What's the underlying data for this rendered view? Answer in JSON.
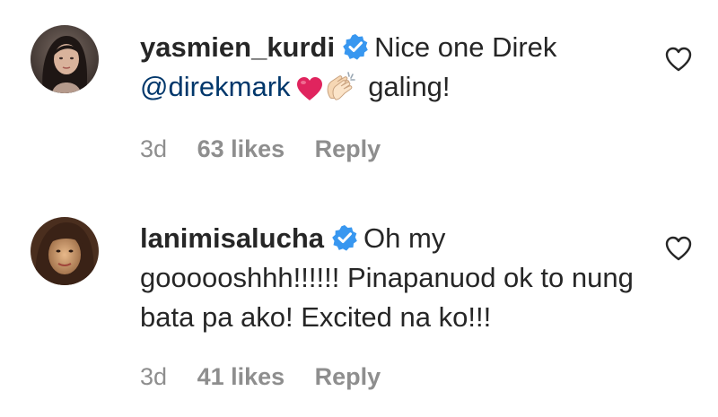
{
  "comments": [
    {
      "username": "yasmien_kurdi",
      "text_before_mention": "Nice one Direk",
      "mention": "@direkmark",
      "text_after_emoji": "galing!",
      "emoji": [
        "red-heart",
        "clapping-hands"
      ],
      "time": "3d",
      "likes": "63 likes",
      "reply": "Reply"
    },
    {
      "username": "lanimisalucha",
      "text": "Oh my goooooshhh!!!!!! Pinapanuod ok to nung bata pa ako! Excited na ko!!!",
      "time": "3d",
      "likes": "41 likes",
      "reply": "Reply"
    }
  ],
  "colors": {
    "text": "#262626",
    "mention": "#00376b",
    "meta": "#8e8e8e",
    "verified": "#3897f0",
    "heart_emoji": "#e0245e"
  },
  "icons": {
    "verified": "verified-badge-icon",
    "like": "heart-outline-icon"
  }
}
